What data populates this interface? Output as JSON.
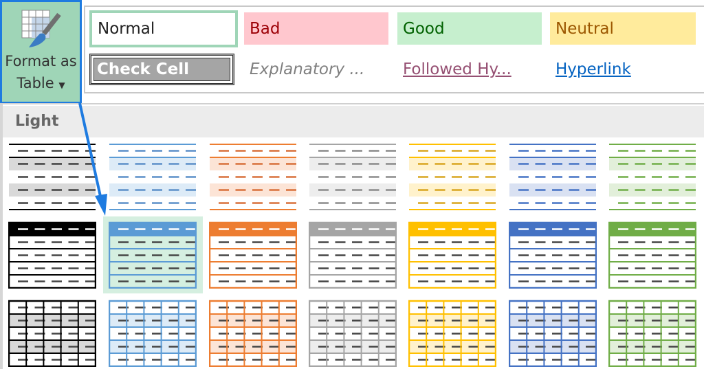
{
  "button": {
    "label_line1": "Format as",
    "label_line2": "Table",
    "icon": "format-as-table-icon",
    "dropdown_icon": "caret-down-icon"
  },
  "cell_styles": [
    {
      "label": "Normal",
      "bg": "#ffffff",
      "color": "#222222"
    },
    {
      "label": "Bad",
      "bg": "#ffc7ce",
      "color": "#9c0006"
    },
    {
      "label": "Good",
      "bg": "#c6efce",
      "color": "#006100"
    },
    {
      "label": "Neutral",
      "bg": "#ffeb9c",
      "color": "#9c5700"
    },
    {
      "label": "Check Cell",
      "bg": "#a5a5a5",
      "color": "#ffffff"
    },
    {
      "label": "Explanatory ...",
      "bg": "#ffffff",
      "color": "#7f7f7f"
    },
    {
      "label": "Followed Hy...",
      "bg": "#ffffff",
      "color": "#954f72"
    },
    {
      "label": "Hyperlink",
      "bg": "#ffffff",
      "color": "#0563c1"
    }
  ],
  "section_label": "Light",
  "selected_style": "medium-blue",
  "palette": [
    {
      "name": "black",
      "main": "#000000",
      "tint": "#d9d9d9",
      "dash": "#404040"
    },
    {
      "name": "blue",
      "main": "#5b9bd5",
      "tint": "#ddebf7",
      "dash": "#5b8fc8"
    },
    {
      "name": "orange",
      "main": "#ed7d31",
      "tint": "#fce4d6",
      "dash": "#d8703a"
    },
    {
      "name": "gray",
      "main": "#a5a5a5",
      "tint": "#ededed",
      "dash": "#8a8a8a"
    },
    {
      "name": "gold",
      "main": "#ffc000",
      "tint": "#fff2cc",
      "dash": "#d8a520"
    },
    {
      "name": "dark-blue",
      "main": "#4472c4",
      "tint": "#d9e1f2",
      "dash": "#4472c4"
    },
    {
      "name": "green",
      "main": "#70ad47",
      "tint": "#e2efda",
      "dash": "#70ad47"
    }
  ],
  "table_style_rows": [
    "light",
    "medium",
    "grid"
  ],
  "accent": "#1e7be0"
}
